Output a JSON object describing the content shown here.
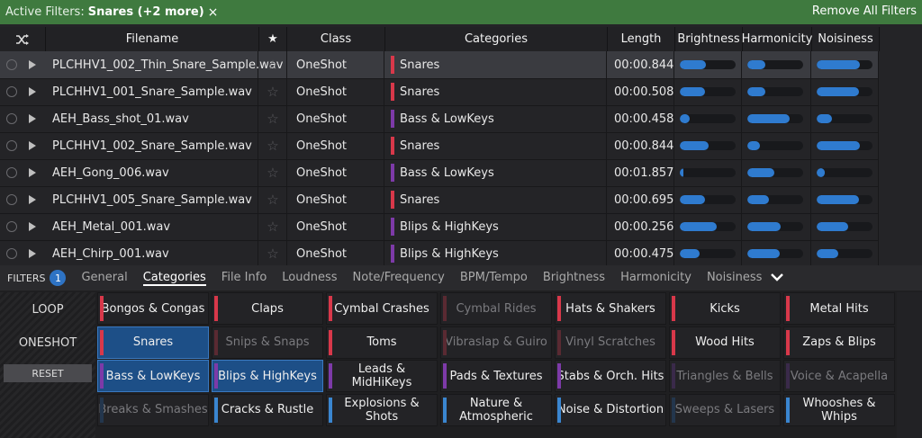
{
  "active_filters": {
    "label": "Active Filters:",
    "value": "Snares (+2 more)",
    "clear": "×",
    "remove_all": "Remove All Filters"
  },
  "columns": [
    "Filename",
    "★",
    "Class",
    "Categories",
    "Length",
    "Brightness",
    "Harmonicity",
    "Noisiness"
  ],
  "colors": {
    "red": "#d8384a",
    "purple": "#7d3aa8",
    "blue": "#3a86d0",
    "accent": "#2e73c4",
    "green": "#3f7a3f"
  },
  "rows": [
    {
      "file": "PLCHHV1_002_Thin_Snare_Sample.wav",
      "cls": "OneShot",
      "cat": "Snares",
      "catColor": "#d8384a",
      "len": "00:00.844",
      "b": 0.47,
      "h": 0.32,
      "n": 0.78
    },
    {
      "file": "PLCHHV1_001_Snare_Sample.wav",
      "cls": "OneShot",
      "cat": "Snares",
      "catColor": "#d8384a",
      "len": "00:00.508",
      "b": 0.45,
      "h": 0.32,
      "n": 0.76
    },
    {
      "file": "AEH_Bass_shot_01.wav",
      "cls": "OneShot",
      "cat": "Bass & LowKeys",
      "catColor": "#7d3aa8",
      "len": "00:00.458",
      "b": 0.18,
      "h": 0.76,
      "n": 0.28
    },
    {
      "file": "PLCHHV1_002_Snare_Sample.wav",
      "cls": "OneShot",
      "cat": "Snares",
      "catColor": "#d8384a",
      "len": "00:00.844",
      "b": 0.52,
      "h": 0.22,
      "n": 0.78
    },
    {
      "file": "AEH_Gong_006.wav",
      "cls": "OneShot",
      "cat": "Bass & LowKeys",
      "catColor": "#7d3aa8",
      "len": "00:01.857",
      "b": 0.06,
      "h": 0.48,
      "n": 0.14
    },
    {
      "file": "PLCHHV1_005_Snare_Sample.wav",
      "cls": "OneShot",
      "cat": "Snares",
      "catColor": "#d8384a",
      "len": "00:00.695",
      "b": 0.45,
      "h": 0.38,
      "n": 0.76
    },
    {
      "file": "AEH_Metal_001.wav",
      "cls": "OneShot",
      "cat": "Blips & HighKeys",
      "catColor": "#7d3aa8",
      "len": "00:00.256",
      "b": 0.66,
      "h": 0.6,
      "n": 0.57
    },
    {
      "file": "AEH_Chirp_001.wav",
      "cls": "OneShot",
      "cat": "Blips & HighKeys",
      "catColor": "#7d3aa8",
      "len": "00:00.475",
      "b": 0.35,
      "h": 0.58,
      "n": 0.39
    }
  ],
  "filters": {
    "label": "FILTERS",
    "count": "1",
    "tabs": [
      "General",
      "Categories",
      "File Info",
      "Loudness",
      "Note/Frequency",
      "BPM/Tempo",
      "Brightness",
      "Harmonicity",
      "Noisiness"
    ],
    "active_tab": "Categories",
    "more_icon": "chevron-down-icon"
  },
  "left": {
    "loop": "LOOP",
    "oneshot": "ONESHOT",
    "reset": "RESET"
  },
  "categories": [
    [
      {
        "t": "Bongos & Congas",
        "c": "#d8384a",
        "s": "n"
      },
      {
        "t": "Claps",
        "c": "#d8384a",
        "s": "n"
      },
      {
        "t": "Cymbal Crashes",
        "c": "#d8384a",
        "s": "n"
      },
      {
        "t": "Cymbal Rides",
        "c": "#5a2a32",
        "s": "d"
      },
      {
        "t": "Hats & Shakers",
        "c": "#d8384a",
        "s": "n"
      },
      {
        "t": "Kicks",
        "c": "#d8384a",
        "s": "n"
      },
      {
        "t": "Metal Hits",
        "c": "#d8384a",
        "s": "n"
      }
    ],
    [
      {
        "t": "Snares",
        "c": "#d8384a",
        "s": "on"
      },
      {
        "t": "Snips & Snaps",
        "c": "#5a2a32",
        "s": "d"
      },
      {
        "t": "Toms",
        "c": "#d8384a",
        "s": "n"
      },
      {
        "t": "Vibraslap & Guiro",
        "c": "#5a2a32",
        "s": "d"
      },
      {
        "t": "Vinyl Scratches",
        "c": "#5a2a32",
        "s": "d"
      },
      {
        "t": "Wood Hits",
        "c": "#d8384a",
        "s": "n"
      },
      {
        "t": "Zaps & Blips",
        "c": "#d8384a",
        "s": "n"
      }
    ],
    [
      {
        "t": "Bass & LowKeys",
        "c": "#7d3aa8",
        "s": "on"
      },
      {
        "t": "Blips & HighKeys",
        "c": "#7d3aa8",
        "s": "on"
      },
      {
        "t": "Leads & MidHiKeys",
        "c": "#7d3aa8",
        "s": "n"
      },
      {
        "t": "Pads & Textures",
        "c": "#7d3aa8",
        "s": "n"
      },
      {
        "t": "Stabs & Orch. Hits",
        "c": "#7d3aa8",
        "s": "n"
      },
      {
        "t": "Triangles & Bells",
        "c": "#3a2a4a",
        "s": "d"
      },
      {
        "t": "Voice & Acapella",
        "c": "#3a2a4a",
        "s": "d"
      }
    ],
    [
      {
        "t": "Breaks & Smashes",
        "c": "#23364d",
        "s": "d"
      },
      {
        "t": "Cracks & Rustle",
        "c": "#3a86d0",
        "s": "n"
      },
      {
        "t": "Explosions & Shots",
        "c": "#3a86d0",
        "s": "n"
      },
      {
        "t": "Nature &\nAtmospheric",
        "c": "#3a86d0",
        "s": "n"
      },
      {
        "t": "Noise & Distortion",
        "c": "#3a86d0",
        "s": "n"
      },
      {
        "t": "Sweeps & Lasers",
        "c": "#23364d",
        "s": "d"
      },
      {
        "t": "Whooshes & Whips",
        "c": "#3a86d0",
        "s": "n"
      }
    ]
  ]
}
